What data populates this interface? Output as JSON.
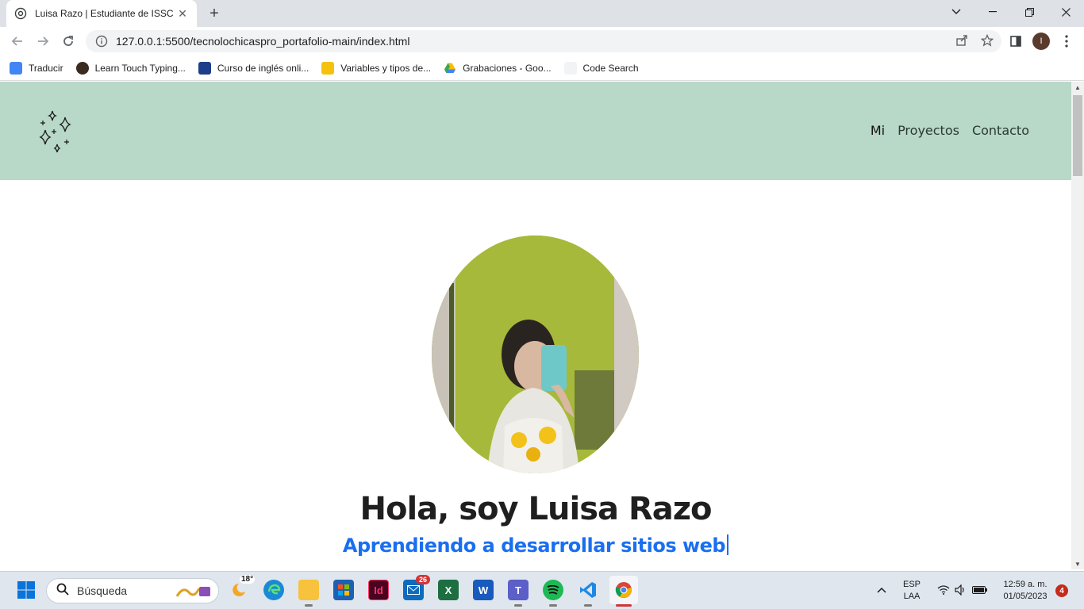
{
  "browser": {
    "tab_title": "Luisa Razo | Estudiante de ISSC",
    "tab_close": "✕",
    "new_tab": "+",
    "url": "127.0.0.1:5500/tecnolochicaspro_portafolio-main/index.html",
    "avatar_letter": "I",
    "bookmarks": [
      {
        "label": "Traducir",
        "color": "#4285f4"
      },
      {
        "label": "Learn Touch Typing...",
        "color": "#3b2a20"
      },
      {
        "label": "Curso de inglés onli...",
        "color": "#1d3f8a"
      },
      {
        "label": "Variables y tipos de...",
        "color": "#f4c20d"
      },
      {
        "label": "Grabaciones - Goo...",
        "color": "#34a853"
      },
      {
        "label": "Code Search",
        "color": "#e8eaed"
      }
    ]
  },
  "site": {
    "nav": [
      {
        "label": "Mi"
      },
      {
        "label": "Proyectos"
      },
      {
        "label": "Contacto"
      }
    ],
    "hero_title": "Hola, soy Luisa Razo",
    "hero_subtitle": "Aprendiendo a desarrollar sitios web"
  },
  "taskbar": {
    "search_placeholder": "Búsqueda",
    "weather": "18°",
    "mail_badge": "26",
    "lang_line1": "ESP",
    "lang_line2": "LAA",
    "time": "12:59 a. m.",
    "date": "01/05/2023",
    "notification_count": "4"
  },
  "colors": {
    "header_bg": "#b8d8c8",
    "subtitle_blue": "#1a6ff0"
  }
}
